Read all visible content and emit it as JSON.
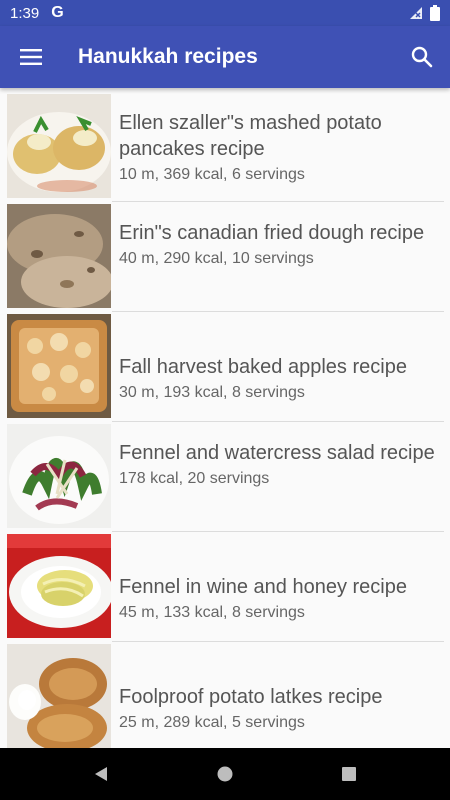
{
  "status_bar": {
    "time": "1:39",
    "g_label": "G"
  },
  "app_bar": {
    "title": "Hanukkah recipes"
  },
  "recipes": [
    {
      "title": "Ellen szaller\"s mashed potato pancakes recipe",
      "details": "10 m, 369 kcal, 6 servings"
    },
    {
      "title": "Erin\"s canadian fried dough recipe",
      "details": "40 m, 290 kcal, 10 servings"
    },
    {
      "title": "Fall harvest baked apples recipe",
      "details": "30 m, 193 kcal, 8 servings"
    },
    {
      "title": "Fennel and watercress salad recipe",
      "details": "178 kcal, 20 servings"
    },
    {
      "title": "Fennel in wine and honey recipe",
      "details": "45 m, 133 kcal, 8 servings"
    },
    {
      "title": "Foolproof potato latkes recipe",
      "details": "25 m, 289 kcal, 5 servings"
    }
  ],
  "colors": {
    "primary": "#3f51b5",
    "status_bar": "#3a4fb0",
    "nav_bar": "#000000"
  }
}
